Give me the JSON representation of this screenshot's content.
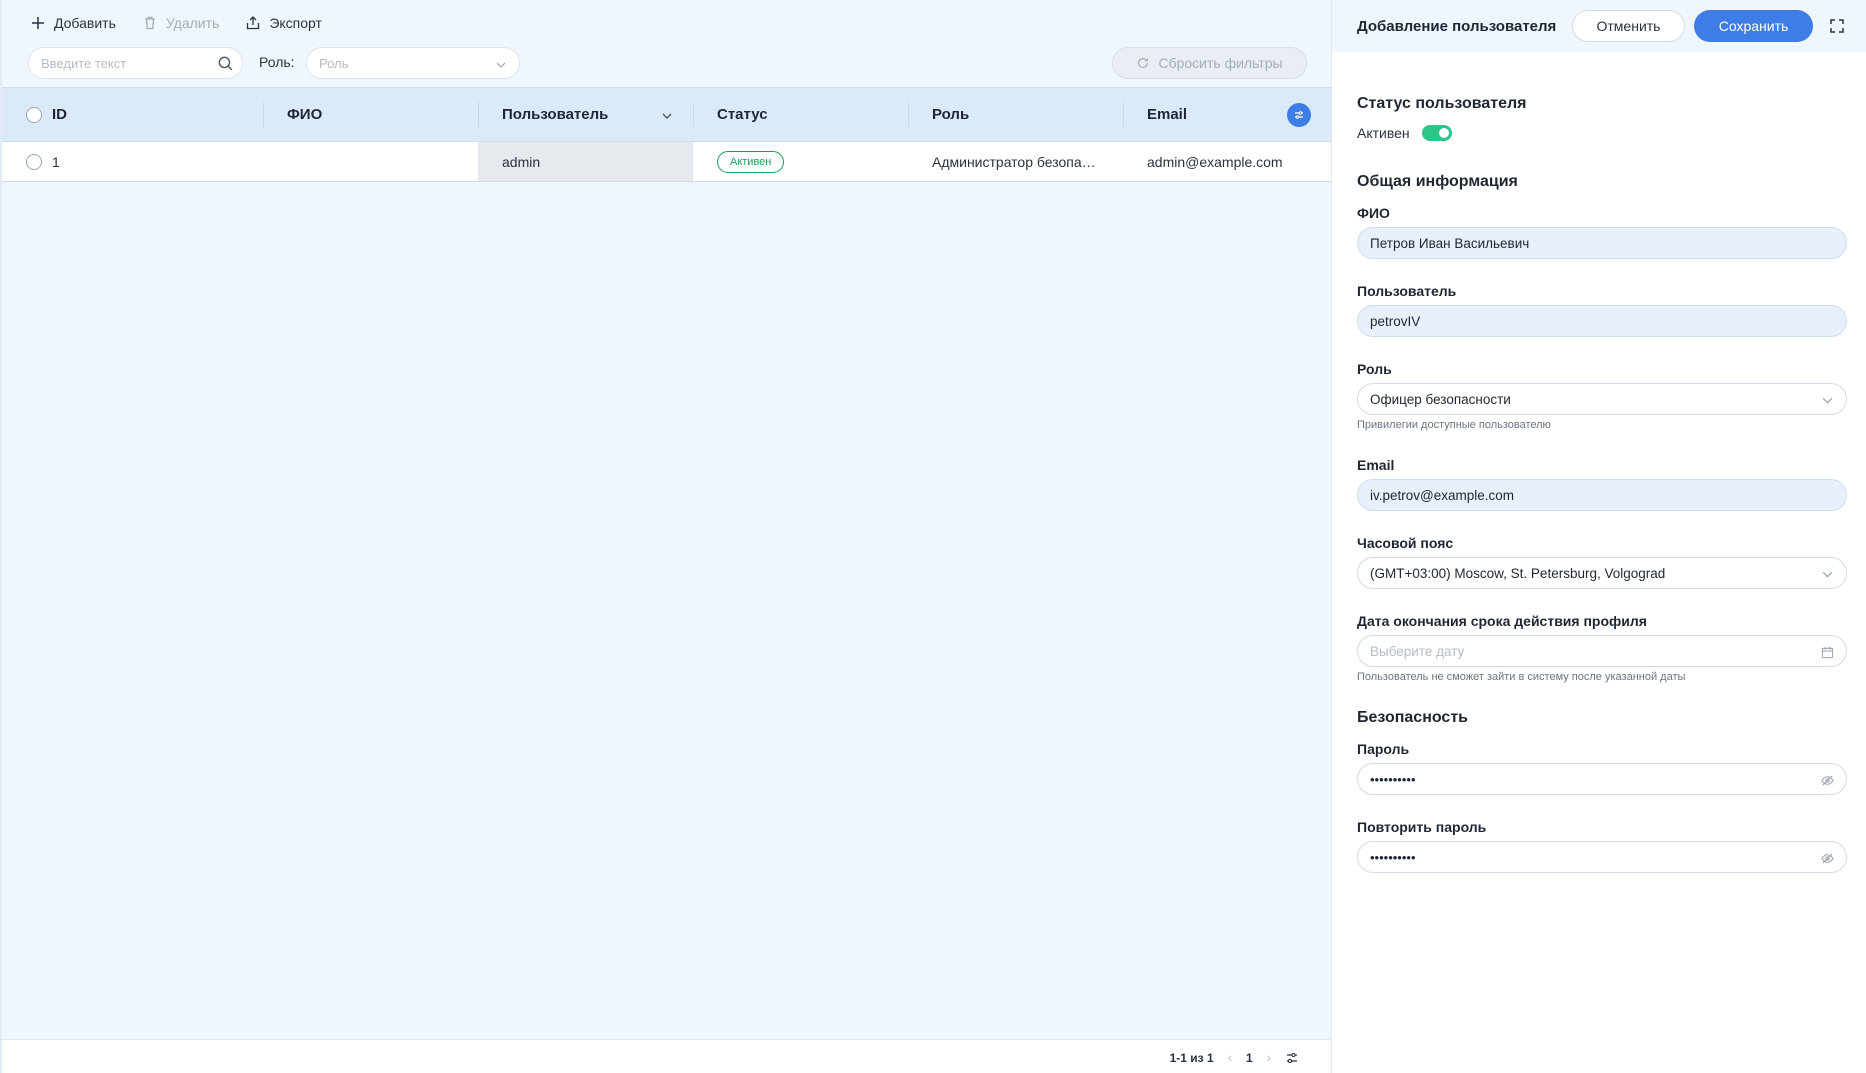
{
  "toolbar": {
    "add_label": "Добавить",
    "delete_label": "Удалить",
    "export_label": "Экспорт"
  },
  "filters": {
    "search_placeholder": "Введите текст",
    "role_label": "Роль:",
    "role_placeholder": "Роль",
    "reset_label": "Сбросить фильтры"
  },
  "table": {
    "columns": [
      "ID",
      "ФИО",
      "Пользователь",
      "Статус",
      "Роль",
      "Email"
    ],
    "rows": [
      {
        "id": "1",
        "fio": "",
        "user": "admin",
        "status": "Активен",
        "role": "Администратор безопасности",
        "email": "admin@example.com"
      }
    ]
  },
  "pagination": {
    "range": "1-1 из 1",
    "page": "1"
  },
  "panel": {
    "title": "Добавление пользователя",
    "cancel_label": "Отменить",
    "save_label": "Сохранить",
    "status_section": "Статус пользователя",
    "active_label": "Активен",
    "active_on": true,
    "general_section": "Общая информация",
    "fio_label": "ФИО",
    "fio_value": "Петров Иван Васильевич",
    "user_label": "Пользователь",
    "user_value": "petrovIV",
    "role_label": "Роль",
    "role_value": "Офицер безопасности",
    "role_hint": "Привилегии доступные пользователю",
    "email_label": "Email",
    "email_value": "iv.petrov@example.com",
    "tz_label": "Часовой пояс",
    "tz_value": "(GMT+03:00) Moscow, St. Petersburg, Volgograd",
    "expiry_label": "Дата окончания срока действия профиля",
    "expiry_placeholder": "Выберите дату",
    "expiry_hint": "Пользователь не сможет зайти в систему после указанной даты",
    "security_section": "Безопасность",
    "password_label": "Пароль",
    "password_value": "••••••••••",
    "repeat_label": "Повторить пароль",
    "repeat_value": "••••••••••"
  },
  "colors": {
    "accent": "#3f7de6",
    "active_green": "#1e9c5e",
    "toggle_green": "#2ec58a",
    "header_bg": "#dbeaf8",
    "pane_bg": "#f0f6fd"
  },
  "icons": [
    "plus-icon",
    "trash-icon",
    "export-icon",
    "search-icon",
    "chevron-down-icon",
    "refresh-icon",
    "columns-settings-icon",
    "chevron-left-icon",
    "chevron-right-icon",
    "sliders-icon",
    "expand-icon",
    "calendar-icon",
    "eye-off-icon"
  ]
}
